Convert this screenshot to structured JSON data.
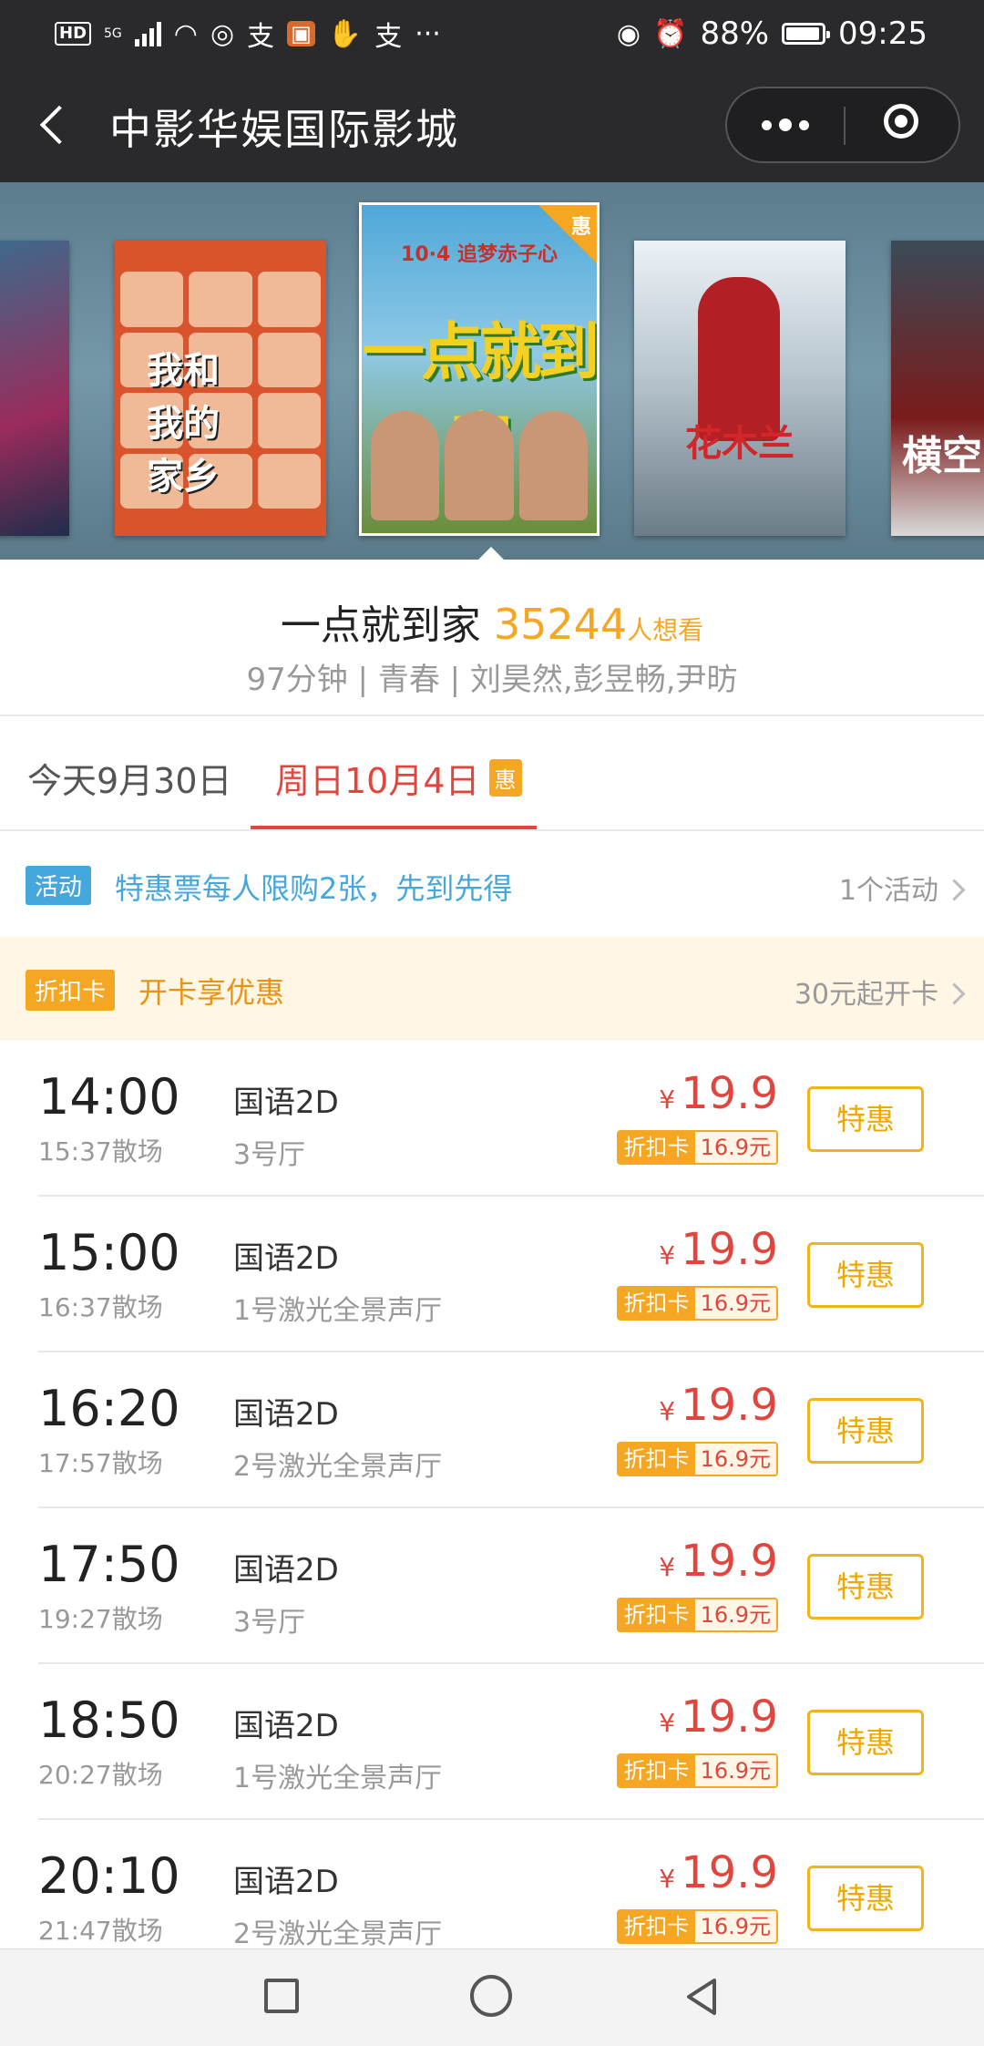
{
  "status_bar": {
    "hd": "HD",
    "network": "5G",
    "battery": "88%",
    "time": "09:25",
    "icons": [
      "signal-icon",
      "wifi-icon",
      "vpn-icon",
      "alipay-icon",
      "app-icon",
      "hand-icon",
      "alipay-icon",
      "more-icon",
      "eye-icon",
      "alarm-icon",
      "battery-icon"
    ]
  },
  "header": {
    "title": "中影华娱国际影城"
  },
  "carousel": {
    "posters": [
      {
        "title": "",
        "active": false
      },
      {
        "title": "我和我的家乡",
        "active": false
      },
      {
        "title": "一点就到家",
        "date_text": "10·4 追梦赤子心",
        "badge": "惠",
        "active": true
      },
      {
        "title": "花木兰",
        "active": false
      },
      {
        "title": "横空",
        "active": false
      }
    ]
  },
  "movie": {
    "title": "一点就到家",
    "want_count": "35244",
    "want_label": "人想看",
    "meta": "97分钟 | 青春 | 刘昊然,彭昱畅,尹昉"
  },
  "date_tabs": [
    {
      "label": "今天9月30日",
      "selected": false
    },
    {
      "label": "周日10月4日",
      "badge": "惠",
      "selected": true
    }
  ],
  "activity": {
    "tag": "活动",
    "text": "特惠票每人限购2张，先到先得",
    "count": "1个活动"
  },
  "card_promo": {
    "tag": "折扣卡",
    "text": "开卡享优惠",
    "price": "30元起开卡"
  },
  "showtimes": [
    {
      "start": "14:00",
      "end": "15:37散场",
      "lang": "国语2D",
      "hall": "3号厅",
      "currency": "¥",
      "price": "19.9",
      "card_label": "折扣卡",
      "card_price": "16.9元",
      "button": "特惠"
    },
    {
      "start": "15:00",
      "end": "16:37散场",
      "lang": "国语2D",
      "hall": "1号激光全景声厅",
      "currency": "¥",
      "price": "19.9",
      "card_label": "折扣卡",
      "card_price": "16.9元",
      "button": "特惠"
    },
    {
      "start": "16:20",
      "end": "17:57散场",
      "lang": "国语2D",
      "hall": "2号激光全景声厅",
      "currency": "¥",
      "price": "19.9",
      "card_label": "折扣卡",
      "card_price": "16.9元",
      "button": "特惠"
    },
    {
      "start": "17:50",
      "end": "19:27散场",
      "lang": "国语2D",
      "hall": "3号厅",
      "currency": "¥",
      "price": "19.9",
      "card_label": "折扣卡",
      "card_price": "16.9元",
      "button": "特惠"
    },
    {
      "start": "18:50",
      "end": "20:27散场",
      "lang": "国语2D",
      "hall": "1号激光全景声厅",
      "currency": "¥",
      "price": "19.9",
      "card_label": "折扣卡",
      "card_price": "16.9元",
      "button": "特惠"
    },
    {
      "start": "20:10",
      "end": "21:47散场",
      "lang": "国语2D",
      "hall": "2号激光全景声厅",
      "currency": "¥",
      "price": "19.9",
      "card_label": "折扣卡",
      "card_price": "16.9元",
      "button": "特惠"
    }
  ],
  "colors": {
    "accent_red": "#e0463d",
    "accent_orange": "#f5a623",
    "activity_blue": "#45a7dc",
    "title_bar": "#2a2a2c"
  }
}
